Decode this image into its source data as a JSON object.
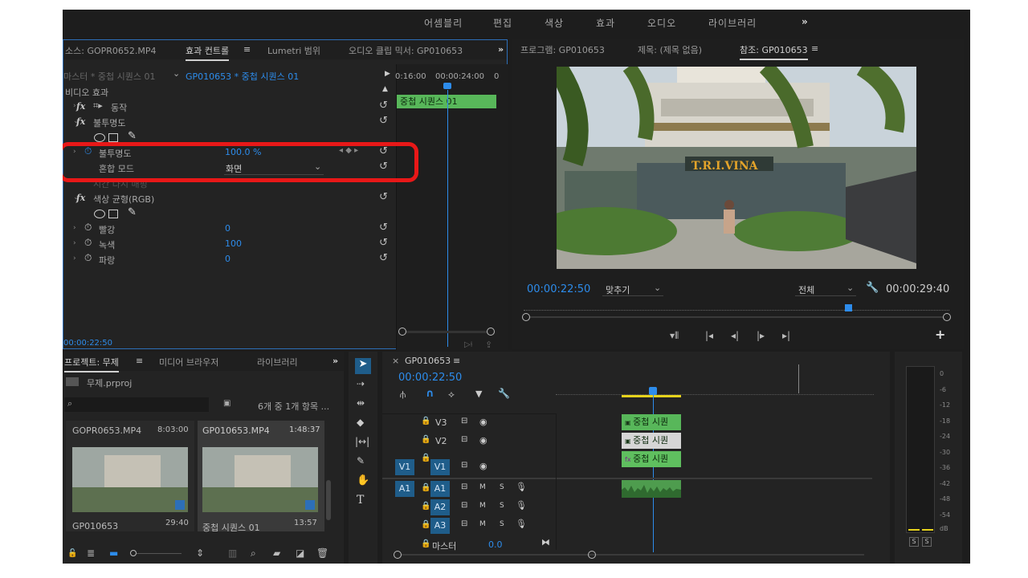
{
  "workspaces": [
    "어셈블리",
    "편집",
    "색상",
    "효과",
    "오디오",
    "라이브러리"
  ],
  "workspace_more": "»",
  "source_panel": {
    "tabs": [
      "소스: GOPR0652.MP4",
      "효과 컨트롤",
      "Lumetri 범위",
      "오디오 클립 믹서: GP010653"
    ],
    "tab_menu": "≡",
    "more": "»",
    "master_label": "마스터 * 중첩 시퀀스 01",
    "clip_label": "GP010653 * 중첩 시퀀스 01",
    "ruler_times": [
      "0:16:00",
      "00:00:24:00",
      "0"
    ],
    "clip_bar": "중첩 시퀀스 01",
    "section": "비디오 효과",
    "motion": "동작",
    "opacity_group": "불투명도",
    "opacity_param": "불투명도",
    "opacity_value": "100.0 %",
    "blend_label": "혼합 모드",
    "blend_value": "화면",
    "hidden_row": "시간 다시 매핑",
    "color_balance": "색상 균형(RGB)",
    "red_label": "빨강",
    "red_value": "0",
    "green_label": "녹색",
    "green_value": "100",
    "blue_label": "파랑",
    "blue_value": "0",
    "timecode": "00:00:22:50"
  },
  "program_panel": {
    "tabs": [
      "프로그램: GP010653",
      "제목: (제목 없음)",
      "참조: GP010653"
    ],
    "tab_menu": "≡",
    "timecode": "00:00:22:50",
    "fit_label": "맞추기",
    "full_label": "전체",
    "duration": "00:00:29:40",
    "add": "+"
  },
  "project_panel": {
    "tabs": [
      "프로젝트: 무제",
      "미디어 브라우저",
      "라이브러리"
    ],
    "tab_menu": "≡",
    "more": "»",
    "project_file": "무제.prproj",
    "item_count": "6개 중 1개 항목 ...",
    "items": [
      {
        "name": "GOPR0653.MP4",
        "duration": "8:03:00",
        "caption": "GP010653",
        "caption_duration": "29:40"
      },
      {
        "name": "GP010653.MP4",
        "duration": "1:48:37",
        "caption": "중첩 시퀀스 01",
        "caption_duration": "13:57"
      }
    ]
  },
  "timeline": {
    "close": "×",
    "name": "GP010653",
    "tab_menu": "≡",
    "timecode": "00:00:22:50",
    "video_tracks": [
      "V3",
      "V2",
      "V1"
    ],
    "audio_tracks": [
      "A1",
      "A2",
      "A3"
    ],
    "target_v": "V1",
    "target_a": "A1",
    "mute": "M",
    "solo": "S",
    "master_label": "마스터",
    "master_value": "0.0",
    "clip_v3": "중첩 시퀀",
    "clip_v2": "중첩 시퀀",
    "clip_v1": "중첩 시퀀"
  },
  "meter": {
    "labels": [
      "0",
      "-6",
      "-12",
      "-18",
      "-24",
      "-30",
      "-36",
      "-42",
      "-48",
      "-54",
      "dB"
    ],
    "solo": [
      "S",
      "S"
    ]
  },
  "colors": {
    "accent": "#2d8ceb",
    "highlight": "#e81818",
    "clip_green": "#58b75a"
  }
}
